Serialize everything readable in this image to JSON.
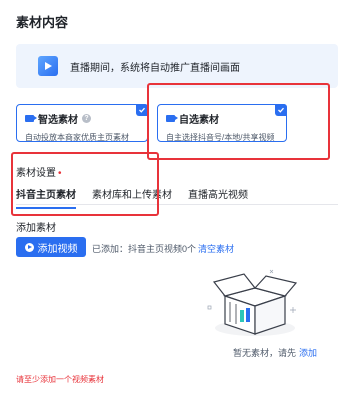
{
  "section_title": "素材内容",
  "banner": {
    "text": "直播期间，系统将自动推广直播间画面"
  },
  "cards": [
    {
      "title": "智选素材",
      "desc": "自动投放本商家优质主页素材",
      "selected": true,
      "has_help": true
    },
    {
      "title": "自选素材",
      "desc": "自主选择抖音号/本地/共享视频",
      "selected": true,
      "has_help": false
    }
  ],
  "settings": {
    "label": "素材设置",
    "required_mark": "•"
  },
  "tabs": [
    {
      "label": "抖音主页素材",
      "active": true
    },
    {
      "label": "素材库和上传素材",
      "active": false
    },
    {
      "label": "直播高光视频",
      "active": false
    }
  ],
  "add_section": {
    "label": "添加素材",
    "button_label": "添加视频",
    "added_text": "已添加：抖音主页视频0个",
    "clear_link": "清空素材"
  },
  "empty_state": {
    "text": "暂无素材，请先",
    "link": "添加"
  },
  "error_text": "请至少添加一个视频素材",
  "colors": {
    "accent": "#2a6ef0",
    "error": "#e8333a",
    "banner_bg": "#eef4fd"
  }
}
